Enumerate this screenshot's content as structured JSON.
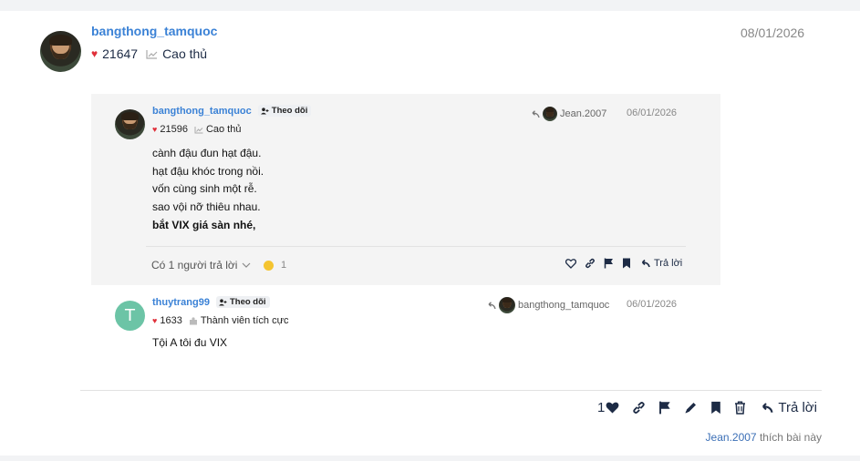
{
  "post": {
    "username": "bangthong_tamquoc",
    "likes": "21647",
    "rank": "Cao thủ",
    "date": "08/01/2026"
  },
  "quote1": {
    "username": "bangthong_tamquoc",
    "follow_label": "Theo dõi",
    "likes": "21596",
    "rank": "Cao thủ",
    "reply_to_user": "Jean.2007",
    "date": "06/01/2026",
    "lines": [
      "cành đậu đun hạt đậu.",
      "hạt đậu khóc trong nồi.",
      "vốn cùng sinh một rễ.",
      "sao vội nỡ thiêu nhau."
    ],
    "bold_line": "bắt VIX giá sàn nhé,",
    "replies_label": "Có 1 người trả lời",
    "reaction_count": "1",
    "reply_label": "Trả lời"
  },
  "quote2": {
    "username": "thuytrang99",
    "avatar_letter": "T",
    "follow_label": "Theo dõi",
    "likes": "1633",
    "rank": "Thành viên tích cực",
    "reply_to_user": "bangthong_tamquoc",
    "date": "06/01/2026",
    "text": "Tội A tôi đu VIX"
  },
  "footer": {
    "like_count": "1",
    "reply_label": "Trả lời",
    "liked_by_user": "Jean.2007",
    "liked_by_suffix": "thích bài này"
  },
  "colors": {
    "username": "#3b82d6",
    "heart": "#e0303a",
    "icon_dark": "#1d2b45",
    "quote_bg": "#f4f4f4",
    "avatar_letter_bg": "#6cc4a6"
  }
}
